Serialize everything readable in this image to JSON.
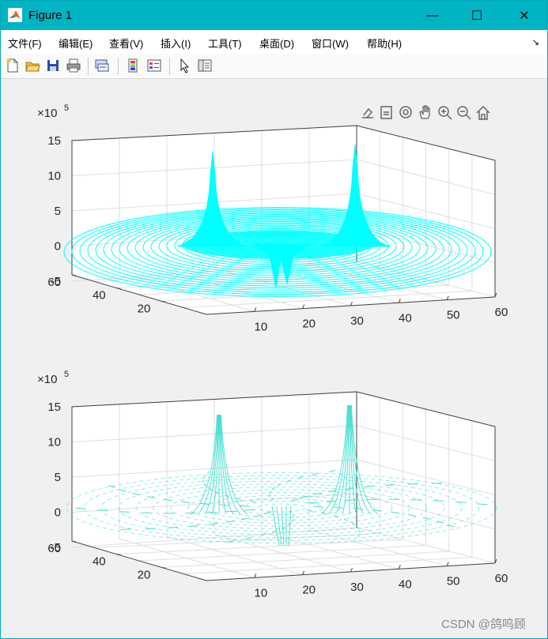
{
  "window": {
    "title": "Figure 1",
    "controls": {
      "minimize": "—",
      "maximize": "☐",
      "close": "✕"
    },
    "accent": "#00b4c3"
  },
  "menubar": {
    "items": [
      "文件(F)",
      "编辑(E)",
      "查看(V)",
      "插入(I)",
      "工具(T)",
      "桌面(D)",
      "窗口(W)",
      "帮助(H)"
    ],
    "more": "↘"
  },
  "toolbar": {
    "icons": [
      "new-figure-icon",
      "open-file-icon",
      "save-icon",
      "print-icon",
      "link-plot-icon",
      "insert-colorbar-icon",
      "insert-legend-icon",
      "edit-plot-icon",
      "property-inspector-icon"
    ]
  },
  "axes_toolbar": {
    "icons": [
      "export-icon",
      "brush-icon",
      "rotate-3d-icon",
      "pan-icon",
      "zoom-in-icon",
      "zoom-out-icon",
      "home-icon"
    ]
  },
  "watermark": "CSDN @鸽呜顾",
  "chart_data": [
    {
      "type": "surface-3d",
      "style": "colored contour lines (cyan)",
      "color": "#00ffff",
      "exponent_label": "×10",
      "exponent": "5",
      "zticks": [
        "15",
        "10",
        "5",
        "0",
        "-5"
      ],
      "zlim": [
        -5,
        15
      ],
      "xticks": [
        "10",
        "20",
        "30",
        "40",
        "50",
        "60"
      ],
      "xlim": [
        0,
        60
      ],
      "yticks": [
        "20",
        "40",
        "60"
      ],
      "ylim": [
        0,
        60
      ],
      "peaks": [
        {
          "label": "left peak",
          "z": 13
        },
        {
          "label": "right peak",
          "z": 14
        },
        {
          "label": "center dips",
          "z": -5
        }
      ],
      "grid": true
    },
    {
      "type": "surface-3d",
      "style": "quiver / sparse line mesh (cyan)",
      "color": "#40e0d0",
      "exponent_label": "×10",
      "exponent": "5",
      "zticks": [
        "15",
        "10",
        "5",
        "0",
        "-5"
      ],
      "zlim": [
        -5,
        15
      ],
      "xticks": [
        "10",
        "20",
        "30",
        "40",
        "50",
        "60"
      ],
      "xlim": [
        0,
        60
      ],
      "yticks": [
        "20",
        "40",
        "60"
      ],
      "ylim": [
        0,
        60
      ],
      "peaks": [
        {
          "label": "left peak",
          "z": 13
        },
        {
          "label": "right peak",
          "z": 14
        },
        {
          "label": "center dips",
          "z": -5
        }
      ],
      "grid": true
    }
  ]
}
